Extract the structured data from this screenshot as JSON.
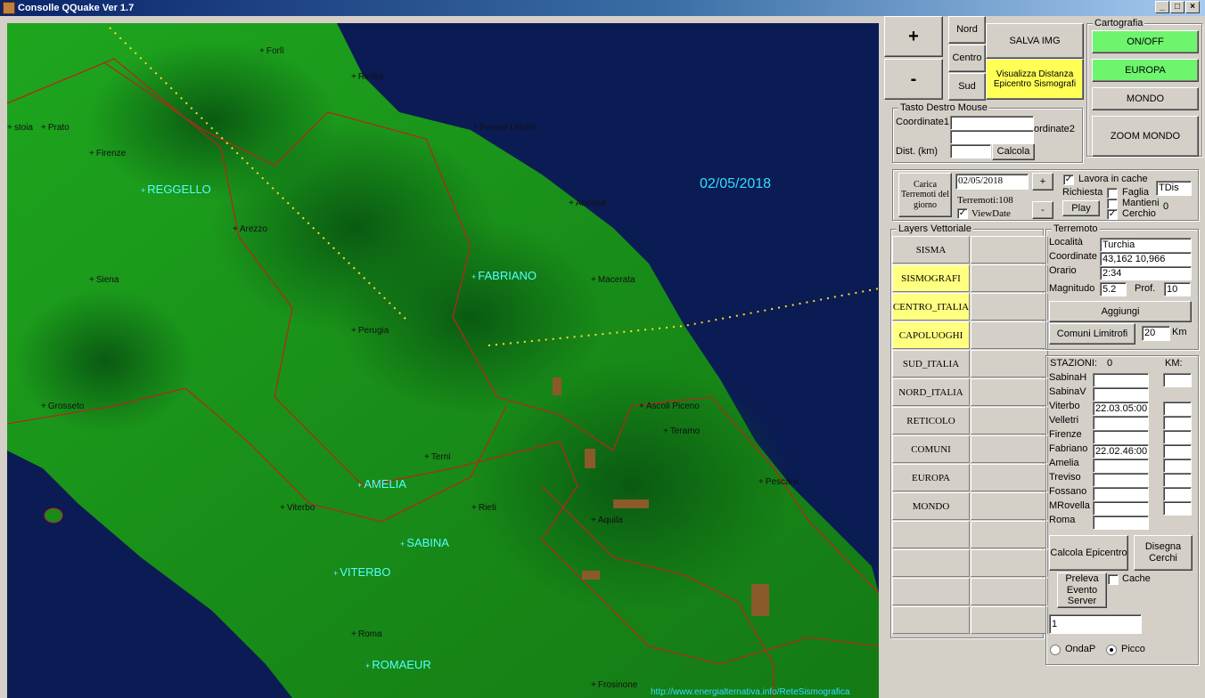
{
  "window": {
    "title": "Consolle QQuake Ver 1.7"
  },
  "map": {
    "date": "02/05/2018",
    "url": "http://www.energialternativa.info/ReteSismografica",
    "cities": [
      "Forlì",
      "Rimini",
      "stoia",
      "Prato",
      "Pesaro Urbino",
      "Firenze",
      "Ancona",
      "Arezzo",
      "Macerata",
      "Siena",
      "Perugia",
      "Grosseto",
      "Ascoli Piceno",
      "Teramo",
      "Terni",
      "Pescara",
      "Viterbo",
      "Rieti",
      "Aquila",
      "Roma",
      "Frosinone"
    ],
    "stations": [
      "REGGELLO",
      "FABRIANO",
      "AMELIA",
      "SABINA",
      "VITERBO",
      "ROMAEUR"
    ]
  },
  "zoom": {
    "plus": "+",
    "minus": "-"
  },
  "nav": {
    "nord": "Nord",
    "centro": "Centro",
    "sud": "Sud"
  },
  "actions": {
    "salva": "SALVA IMG",
    "visualizza": "Visualizza Distanza Epicentro Sismografi"
  },
  "cartografia": {
    "label": "Cartografia",
    "onoff": "ON/OFF",
    "europa": "EUROPA",
    "mondo": "MONDO",
    "zoom_mondo": "ZOOM MONDO"
  },
  "mouse": {
    "label": "Tasto Destro Mouse",
    "coord1": "Coordinate1",
    "coord2": "ordinate2",
    "dist": "Dist. (km)",
    "calcola": "Calcola",
    "coord1_value": "",
    "coord2_value": "",
    "dist_value": ""
  },
  "carica": {
    "button": "Carica Terremoti del giorno",
    "date": "02/05/2018",
    "plus": "+",
    "minus": "-",
    "terremoti": "Terremoti:108",
    "viewdate": "ViewDate",
    "lavora_cache": "Lavora in cache",
    "richiesta": "Richiesta",
    "faglia": "Faglia",
    "mantieni": "Mantieni",
    "cerchio": "Cerchio",
    "tdis": "TDis",
    "play": "Play",
    "zero": "0"
  },
  "layers": {
    "label": "Layers Vettoriale",
    "items": [
      "SISMA",
      "SISMOGRAFI",
      "CENTRO_ITALIA",
      "CAPOLUOGHI",
      "SUD_ITALIA",
      "NORD_ITALIA",
      "RETICOLO",
      "COMUNI",
      "EUROPA",
      "MONDO"
    ]
  },
  "terremoto": {
    "label": "Terremoto",
    "localita_label": "Località",
    "localita": "Turchia",
    "coordinate_label": "Coordinate",
    "coordinate": "43,162 10,966",
    "orario_label": "Orario",
    "orario": "2:34",
    "magnitudo_label": "Magnitudo",
    "magnitudo": "5.2",
    "prof_label": "Prof.",
    "prof": "10",
    "aggiungi": "Aggiungi",
    "comuni": "Comuni Limitrofi",
    "km_value": "20",
    "km_label": "Km"
  },
  "stazioni": {
    "header": "STAZIONI:",
    "count": "0",
    "km_label": "KM:",
    "names": [
      "SabinaH",
      "SabinaV",
      "Viterbo",
      "Velletri",
      "Firenze",
      "Fabriano",
      "Amelia",
      "Treviso",
      "Fossano",
      "MRovella",
      "Roma"
    ],
    "times": [
      "",
      "",
      "22.03.05:00",
      "",
      "",
      "22.02.46:00",
      "",
      "",
      "",
      "",
      ""
    ],
    "calcola": "Calcola Epicentro",
    "disegna": "Disegna Cerchi",
    "preleva": "Preleva Evento Server",
    "cache": "Cache",
    "input_value": "1",
    "ondap": "OndaP",
    "picco": "Picco"
  }
}
